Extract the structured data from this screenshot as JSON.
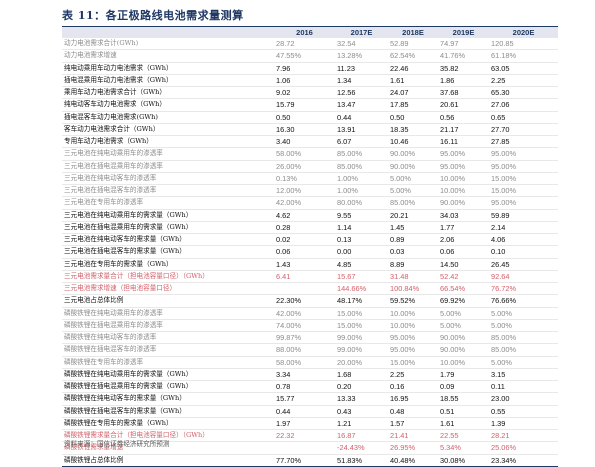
{
  "title": "表 11：各正极路线电池需求量测算",
  "columns": [
    "",
    "2016",
    "2017E",
    "2018E",
    "2019E",
    "2020E"
  ],
  "rows": [
    {
      "label": "动力电池需求合计(GWh)",
      "style": "gray",
      "values": [
        "28.72",
        "32.54",
        "52.89",
        "74.97",
        "120.85"
      ]
    },
    {
      "label": "动力电池需求增速",
      "style": "gray",
      "values": [
        "47.55%",
        "13.28%",
        "62.54%",
        "41.76%",
        "61.18%"
      ]
    },
    {
      "label": "纯电动乘用车动力电池需求（GWh）",
      "style": "normal",
      "values": [
        "7.96",
        "11.23",
        "22.46",
        "35.82",
        "63.05"
      ]
    },
    {
      "label": "插电混乘用车动力电池需求（GWh）",
      "style": "normal",
      "values": [
        "1.06",
        "1.34",
        "1.61",
        "1.86",
        "2.25"
      ]
    },
    {
      "label": "乘用车动力电池需求合计（GWh）",
      "style": "normal",
      "values": [
        "9.02",
        "12.56",
        "24.07",
        "37.68",
        "65.30"
      ]
    },
    {
      "label": "纯电动客车动力电池需求（GWh）",
      "style": "normal",
      "values": [
        "15.79",
        "13.47",
        "17.85",
        "20.61",
        "27.06"
      ]
    },
    {
      "label": "插电混客车动力电池需求(GWh)",
      "style": "normal",
      "values": [
        "0.50",
        "0.44",
        "0.50",
        "0.56",
        "0.65"
      ]
    },
    {
      "label": "客车动力电池需求合计（GWh）",
      "style": "normal",
      "values": [
        "16.30",
        "13.91",
        "18.35",
        "21.17",
        "27.70"
      ]
    },
    {
      "label": "专用车动力电池需求（GWh）",
      "style": "normal",
      "values": [
        "3.40",
        "6.07",
        "10.46",
        "16.11",
        "27.85"
      ]
    },
    {
      "label": "三元电池在纯电动乘用车的渗透率",
      "style": "gray",
      "values": [
        "58.00%",
        "85.00%",
        "90.00%",
        "95.00%",
        "95.00%"
      ]
    },
    {
      "label": "三元电池在插电混乘用车的渗透率",
      "style": "gray",
      "values": [
        "26.00%",
        "85.00%",
        "90.00%",
        "95.00%",
        "95.00%"
      ]
    },
    {
      "label": "三元电池在纯电动客车的渗透率",
      "style": "gray",
      "values": [
        "0.13%",
        "1.00%",
        "5.00%",
        "10.00%",
        "15.00%"
      ]
    },
    {
      "label": "三元电池在插电混客车的渗透率",
      "style": "gray",
      "values": [
        "12.00%",
        "1.00%",
        "5.00%",
        "10.00%",
        "15.00%"
      ]
    },
    {
      "label": "三元电池在专用车的渗透率",
      "style": "gray",
      "values": [
        "42.00%",
        "80.00%",
        "85.00%",
        "90.00%",
        "95.00%"
      ]
    },
    {
      "label": "三元电池在纯电动乘用车的需求量（GWh）",
      "style": "normal",
      "values": [
        "4.62",
        "9.55",
        "20.21",
        "34.03",
        "59.89"
      ]
    },
    {
      "label": "三元电池在插电混乘用车的需求量（GWh）",
      "style": "normal",
      "values": [
        "0.28",
        "1.14",
        "1.45",
        "1.77",
        "2.14"
      ]
    },
    {
      "label": "三元电池在纯电动客车的需求量（GWh）",
      "style": "normal",
      "values": [
        "0.02",
        "0.13",
        "0.89",
        "2.06",
        "4.06"
      ]
    },
    {
      "label": "三元电池在插电混客车的需求量（GWh）",
      "style": "normal",
      "values": [
        "0.06",
        "0.00",
        "0.03",
        "0.06",
        "0.10"
      ]
    },
    {
      "label": "三元电池在专用车的需求量（GWh）",
      "style": "normal",
      "values": [
        "1.43",
        "4.85",
        "8.89",
        "14.50",
        "26.45"
      ]
    },
    {
      "label": "三元电池需求量合计（担电池容量口径）（GWh）",
      "style": "red",
      "values": [
        "6.41",
        "15.67",
        "31.48",
        "52.42",
        "92.64"
      ]
    },
    {
      "label": "三元电池需求增速（担电池容量口径）",
      "style": "red",
      "values": [
        "",
        "144.66%",
        "100.84%",
        "66.54%",
        "76.72%"
      ]
    },
    {
      "label": "三元电池占总体比例",
      "style": "normal",
      "values": [
        "22.30%",
        "48.17%",
        "59.52%",
        "69.92%",
        "76.66%"
      ]
    },
    {
      "label": "磷酸铁锂在纯电动乘用车的渗透率",
      "style": "gray",
      "values": [
        "42.00%",
        "15.00%",
        "10.00%",
        "5.00%",
        "5.00%"
      ]
    },
    {
      "label": "磷酸铁锂在插电混乘用车的渗透率",
      "style": "gray",
      "values": [
        "74.00%",
        "15.00%",
        "10.00%",
        "5.00%",
        "5.00%"
      ]
    },
    {
      "label": "磷酸铁锂在纯电动客车的渗透率",
      "style": "gray",
      "values": [
        "99.87%",
        "99.00%",
        "95.00%",
        "90.00%",
        "85.00%"
      ]
    },
    {
      "label": "磷酸铁锂在插电混客车的渗透率",
      "style": "gray",
      "values": [
        "88.00%",
        "99.00%",
        "95.00%",
        "90.00%",
        "85.00%"
      ]
    },
    {
      "label": "磷酸铁锂在专用车的渗透率",
      "style": "gray",
      "values": [
        "58.00%",
        "20.00%",
        "15.00%",
        "10.00%",
        "5.00%"
      ]
    },
    {
      "label": "磷酸铁锂在纯电动乘用车的需求量（GWh）",
      "style": "normal",
      "values": [
        "3.34",
        "1.68",
        "2.25",
        "1.79",
        "3.15"
      ]
    },
    {
      "label": "磷酸铁锂在插电混乘用车的需求量（GWh）",
      "style": "normal",
      "values": [
        "0.78",
        "0.20",
        "0.16",
        "0.09",
        "0.11"
      ]
    },
    {
      "label": "磷酸铁锂在纯电动客车的需求量（GWh）",
      "style": "normal",
      "values": [
        "15.77",
        "13.33",
        "16.95",
        "18.55",
        "23.00"
      ]
    },
    {
      "label": "磷酸铁锂在插电混客车的需求量（GWh）",
      "style": "normal",
      "values": [
        "0.44",
        "0.43",
        "0.48",
        "0.51",
        "0.55"
      ]
    },
    {
      "label": "磷酸铁锂在专用车的需求量（GWh）",
      "style": "normal",
      "values": [
        "1.97",
        "1.21",
        "1.57",
        "1.61",
        "1.39"
      ]
    },
    {
      "label": "磷酸铁锂需求量合计（担电池容量口径）（GWh）",
      "style": "red",
      "values": [
        "22.32",
        "16.87",
        "21.41",
        "22.55",
        "28.21"
      ]
    },
    {
      "label": "磷酸铁锂需求量增速",
      "style": "red",
      "values": [
        "",
        "-24.43%",
        "26.95%",
        "5.34%",
        "25.06%"
      ]
    },
    {
      "label": "磷酸铁锂占总体比例",
      "style": "normal",
      "values": [
        "77.70%",
        "51.83%",
        "40.48%",
        "30.08%",
        "23.34%"
      ]
    }
  ],
  "source": "资料来源：国信证券经济研究所预测",
  "colors": {
    "header_bg": "#e3e6ee",
    "title": "#1f3864",
    "gray_text": "#8c8c8c",
    "red_text": "#d0616a"
  }
}
